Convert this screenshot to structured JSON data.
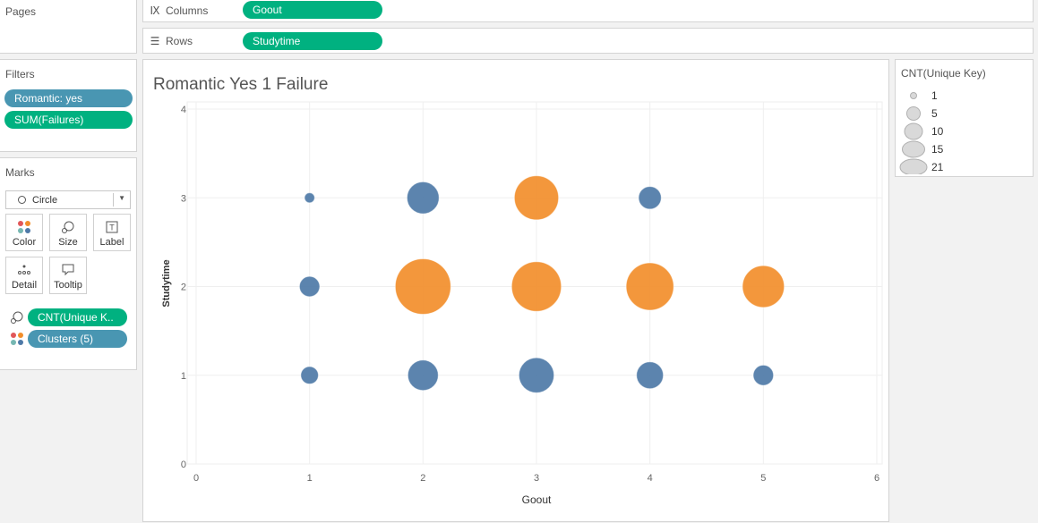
{
  "pages": {
    "title": "Pages"
  },
  "shelves": {
    "columns": {
      "label": "Columns",
      "pill": "Goout"
    },
    "rows": {
      "label": "Rows",
      "pill": "Studytime"
    }
  },
  "filters": {
    "title": "Filters",
    "pills": [
      "Romantic: yes",
      "SUM(Failures)"
    ]
  },
  "marks": {
    "title": "Marks",
    "mark_type": "Circle",
    "cards": [
      "Color",
      "Size",
      "Label",
      "Detail",
      "Tooltip"
    ],
    "size_pill": "CNT(Unique K..",
    "color_pill": "Clusters (5)"
  },
  "legend": {
    "title": "CNT(Unique Key)",
    "entries": [
      "1",
      "5",
      "10",
      "15",
      "21"
    ]
  },
  "colors": {
    "blue": "#4e79a7",
    "orange": "#f28e2b",
    "green_pill": "#00b180",
    "blue_pill": "#4996b2"
  },
  "chart_data": {
    "type": "scatter",
    "title": "Romantic Yes 1 Failure",
    "xlabel": "Goout",
    "ylabel": "Studytime",
    "xlim": [
      0,
      6
    ],
    "ylim": [
      0,
      4
    ],
    "xticks": [
      "0",
      "1",
      "2",
      "3",
      "4",
      "5",
      "6"
    ],
    "yticks": [
      "0",
      "1",
      "2",
      "3",
      "4"
    ],
    "grid": true,
    "size_measure": "CNT(Unique Key)",
    "points": [
      {
        "x": 1,
        "y": 3,
        "size": 1,
        "cluster": "blue"
      },
      {
        "x": 2,
        "y": 3,
        "size": 10,
        "cluster": "blue"
      },
      {
        "x": 3,
        "y": 3,
        "size": 19,
        "cluster": "orange"
      },
      {
        "x": 4,
        "y": 3,
        "size": 5,
        "cluster": "blue"
      },
      {
        "x": 1,
        "y": 2,
        "size": 4,
        "cluster": "blue"
      },
      {
        "x": 2,
        "y": 2,
        "size": 30,
        "cluster": "orange"
      },
      {
        "x": 3,
        "y": 2,
        "size": 24,
        "cluster": "orange"
      },
      {
        "x": 4,
        "y": 2,
        "size": 22,
        "cluster": "orange"
      },
      {
        "x": 5,
        "y": 2,
        "size": 17,
        "cluster": "orange"
      },
      {
        "x": 1,
        "y": 1,
        "size": 3,
        "cluster": "blue"
      },
      {
        "x": 2,
        "y": 1,
        "size": 9,
        "cluster": "blue"
      },
      {
        "x": 3,
        "y": 1,
        "size": 12,
        "cluster": "blue"
      },
      {
        "x": 4,
        "y": 1,
        "size": 7,
        "cluster": "blue"
      },
      {
        "x": 5,
        "y": 1,
        "size": 4,
        "cluster": "blue"
      }
    ]
  }
}
